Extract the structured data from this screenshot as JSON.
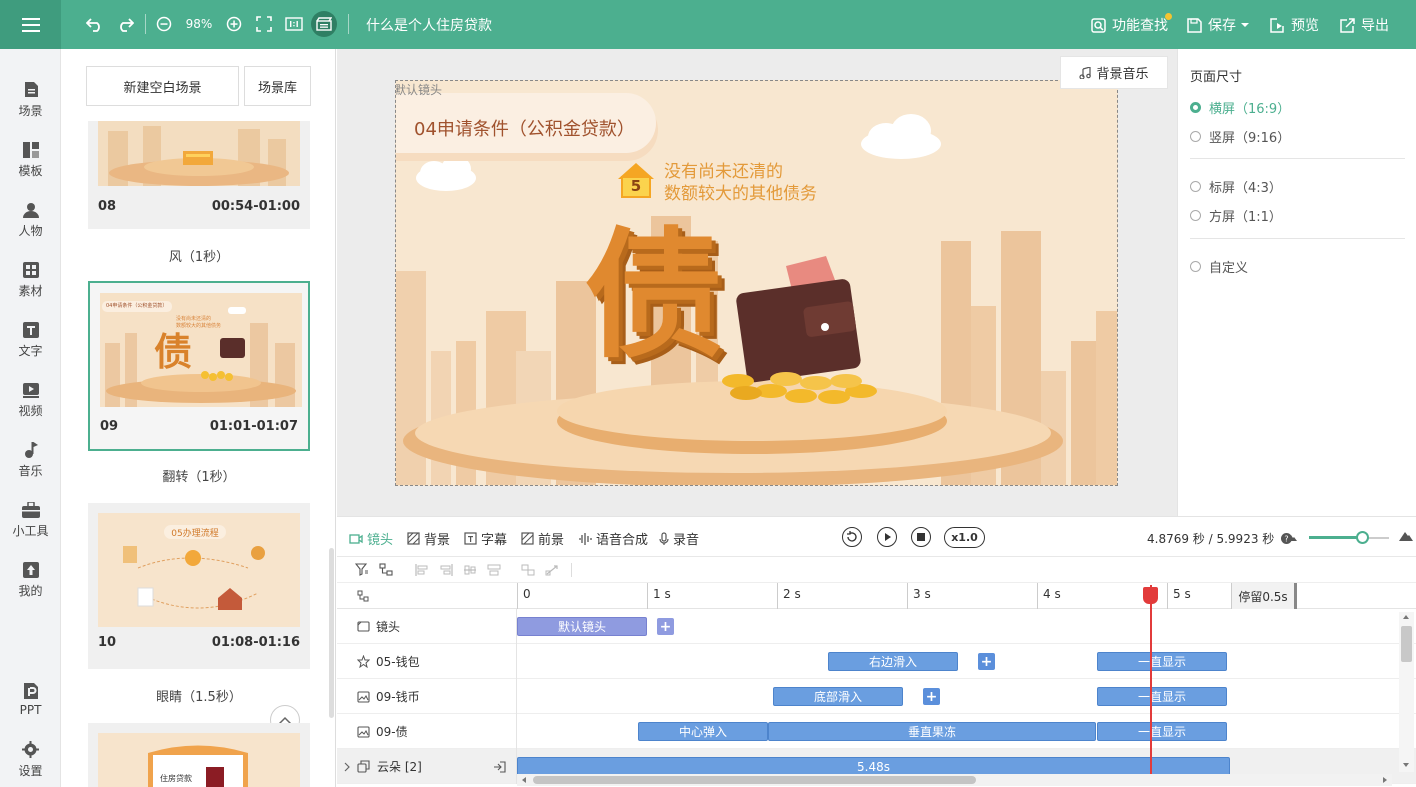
{
  "topbar": {
    "zoom": "98%",
    "doc_title": "什么是个人住房贷款",
    "feature_search": "功能查找",
    "save": "保存",
    "preview": "预览",
    "export": "导出"
  },
  "sidebar": {
    "items": [
      {
        "label": "场景",
        "icon": "scene-icon"
      },
      {
        "label": "模板",
        "icon": "template-icon"
      },
      {
        "label": "人物",
        "icon": "person-icon"
      },
      {
        "label": "素材",
        "icon": "material-icon"
      },
      {
        "label": "文字",
        "icon": "text-icon"
      },
      {
        "label": "视频",
        "icon": "video-icon"
      },
      {
        "label": "音乐",
        "icon": "music-icon"
      },
      {
        "label": "小工具",
        "icon": "toolbox-icon"
      },
      {
        "label": "我的",
        "icon": "my-icon"
      },
      {
        "label": "PPT",
        "icon": "ppt-icon"
      },
      {
        "label": "设置",
        "icon": "settings-icon"
      }
    ]
  },
  "scenes": {
    "new_blank": "新建空白场景",
    "library": "场景库",
    "cards": [
      {
        "num": "08",
        "time": "00:54-01:00"
      },
      {
        "num": "09",
        "time": "01:01-01:07",
        "thumb_title": "04申请条件（公积金贷款）",
        "thumb_text_1": "没有尚未还清的",
        "thumb_text_2": "数额较大的其他债务",
        "thumb_char": "债"
      },
      {
        "num": "10",
        "time": "01:08-01:16",
        "thumb_title": "05办理流程"
      },
      {
        "thumb_label": "住房贷款"
      }
    ],
    "transitions": [
      "风（1秒）",
      "翻转（1秒）",
      "眼睛（1.5秒）"
    ]
  },
  "canvas": {
    "camera_label": "默认镜头",
    "bg_music": "背景音乐",
    "slide_title": "04申请条件（公积金贷款）",
    "badge_number": "5",
    "line1": "没有尚未还清的",
    "line2": "数额较大的其他债务",
    "big_char": "债"
  },
  "props": {
    "heading": "页面尺寸",
    "options": [
      "横屏（16:9）",
      "竖屏（9:16）",
      "标屏（4:3）",
      "方屏（1:1）",
      "自定义"
    ]
  },
  "timeline": {
    "tabs": [
      "镜头",
      "背景",
      "字幕",
      "前景",
      "语音合成",
      "录音"
    ],
    "speed": "x1.0",
    "time": "4.8769 秒 / 5.9923 秒",
    "ruler": [
      "0",
      "1 s",
      "2 s",
      "3 s",
      "4 s",
      "5 s"
    ],
    "pause": "停留0.5s",
    "tracks": [
      {
        "label": "镜头",
        "clips": [
          "默认镜头"
        ]
      },
      {
        "label": "05-钱包",
        "clips": [
          "右边滑入",
          "一直显示"
        ]
      },
      {
        "label": "09-钱币",
        "clips": [
          "底部滑入",
          "一直显示"
        ]
      },
      {
        "label": "09-债",
        "clips": [
          "中心弹入",
          "垂直果冻",
          "一直显示"
        ]
      },
      {
        "label": "云朵 [2]",
        "clips": [
          "5.48s"
        ]
      }
    ]
  }
}
